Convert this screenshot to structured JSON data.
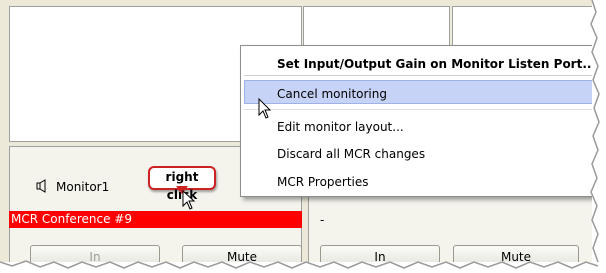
{
  "monitor": {
    "label": "Monitor1",
    "conference": "MCR Conference #9",
    "buttons": {
      "in": "In",
      "mute": "Mute"
    }
  },
  "monitor2": {
    "top_value": "-",
    "conference": "-",
    "buttons": {
      "in": "In",
      "mute": "Mute"
    }
  },
  "callout": {
    "text": "right click"
  },
  "context_menu": {
    "items": [
      "Set Input/Output Gain on Monitor Listen Port...",
      "Cancel monitoring",
      "Edit monitor layout...",
      "Discard all MCR changes",
      "MCR Properties"
    ],
    "highlighted_index": 1
  },
  "colors": {
    "conference_bar": "#ff0000",
    "menu_highlight": "#c6d3f7",
    "callout_border": "#cc2222"
  }
}
